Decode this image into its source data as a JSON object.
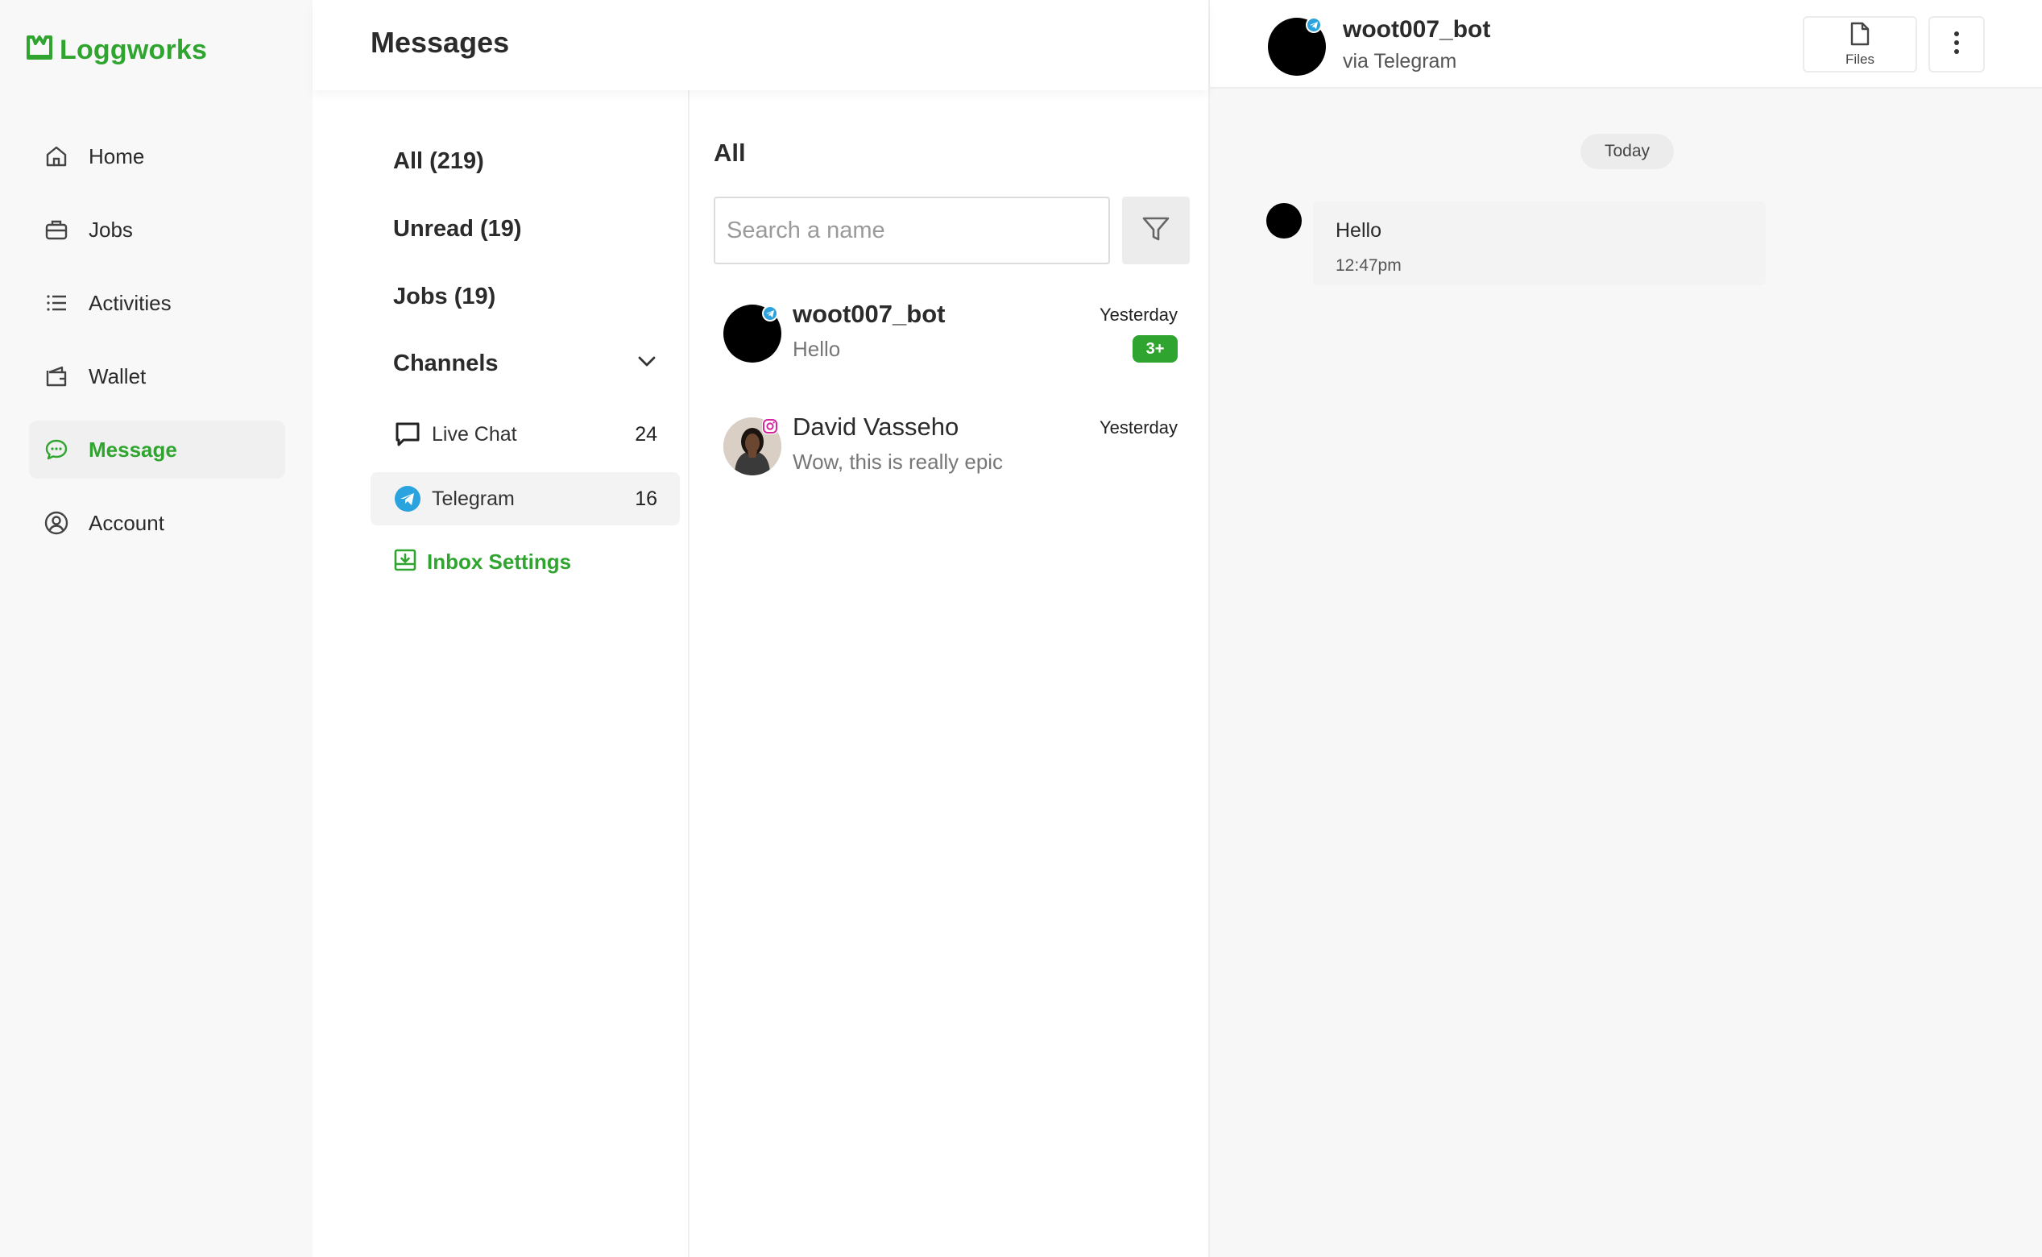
{
  "app": {
    "name": "Loggworks",
    "brand_color": "#2fa52f"
  },
  "sidebar": {
    "items": [
      {
        "label": "Home",
        "icon": "home-icon"
      },
      {
        "label": "Jobs",
        "icon": "briefcase-icon"
      },
      {
        "label": "Activities",
        "icon": "list-icon"
      },
      {
        "label": "Wallet",
        "icon": "wallet-icon"
      },
      {
        "label": "Message",
        "icon": "message-icon",
        "active": true
      },
      {
        "label": "Account",
        "icon": "user-circle-icon"
      }
    ]
  },
  "header": {
    "title": "Messages"
  },
  "filters": {
    "all": "All (219)",
    "unread": "Unread (19)",
    "jobs": "Jobs  (19)",
    "channels_label": "Channels",
    "channels": [
      {
        "name": "Live Chat",
        "count": "24",
        "icon": "live-chat-icon"
      },
      {
        "name": "Telegram",
        "count": "16",
        "icon": "telegram-icon",
        "active": true
      }
    ],
    "inbox_settings": "Inbox Settings"
  },
  "conversations": {
    "title": "All",
    "search_placeholder": "Search a name",
    "items": [
      {
        "name": "woot007_bot",
        "preview": "Hello",
        "time": "Yesterday",
        "unread": "3+",
        "channel": "telegram"
      },
      {
        "name": "David Vasseho",
        "preview": "Wow, this is really epic",
        "time": "Yesterday",
        "channel": "instagram"
      }
    ]
  },
  "chat": {
    "name": "woot007_bot",
    "via": "via Telegram",
    "files_label": "Files",
    "date_divider": "Today",
    "messages": [
      {
        "text": "Hello",
        "time": "12:47pm"
      }
    ]
  }
}
